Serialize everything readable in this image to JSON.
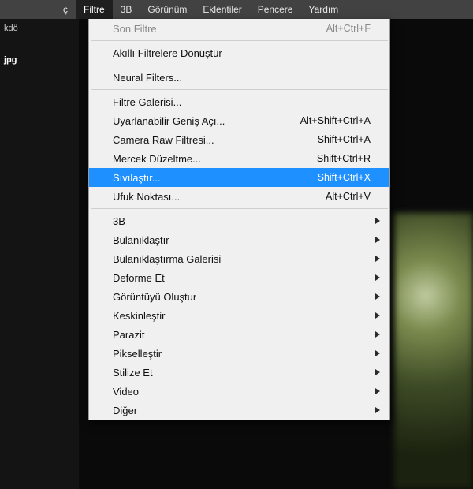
{
  "menubar": {
    "partial_left": "ç",
    "items": [
      {
        "label": "Filtre",
        "active": true
      },
      {
        "label": "3B"
      },
      {
        "label": "Görünüm"
      },
      {
        "label": "Eklentiler"
      },
      {
        "label": "Pencere"
      },
      {
        "label": "Yardım"
      }
    ]
  },
  "bg": {
    "label1": "kdö",
    "label2": "jpg"
  },
  "dropdown": {
    "items": [
      {
        "label": "Son Filtre",
        "shortcut": "Alt+Ctrl+F",
        "disabled": true
      },
      {
        "sep": true
      },
      {
        "label": "Akıllı Filtrelere Dönüştür"
      },
      {
        "sep": true
      },
      {
        "label": "Neural Filters..."
      },
      {
        "sep": true
      },
      {
        "label": "Filtre Galerisi..."
      },
      {
        "label": "Uyarlanabilir Geniş Açı...",
        "shortcut": "Alt+Shift+Ctrl+A"
      },
      {
        "label": "Camera Raw Filtresi...",
        "shortcut": "Shift+Ctrl+A"
      },
      {
        "label": "Mercek Düzeltme...",
        "shortcut": "Shift+Ctrl+R"
      },
      {
        "label": "Sıvılaştır...",
        "shortcut": "Shift+Ctrl+X",
        "highlight": true
      },
      {
        "label": "Ufuk Noktası...",
        "shortcut": "Alt+Ctrl+V"
      },
      {
        "sep": true
      },
      {
        "label": "3B",
        "submenu": true
      },
      {
        "label": "Bulanıklaştır",
        "submenu": true
      },
      {
        "label": "Bulanıklaştırma Galerisi",
        "submenu": true
      },
      {
        "label": "Deforme Et",
        "submenu": true
      },
      {
        "label": "Görüntüyü Oluştur",
        "submenu": true
      },
      {
        "label": "Keskinleştir",
        "submenu": true
      },
      {
        "label": "Parazit",
        "submenu": true
      },
      {
        "label": "Pikselleştir",
        "submenu": true
      },
      {
        "label": "Stilize Et",
        "submenu": true
      },
      {
        "label": "Video",
        "submenu": true
      },
      {
        "label": "Diğer",
        "submenu": true
      }
    ]
  }
}
